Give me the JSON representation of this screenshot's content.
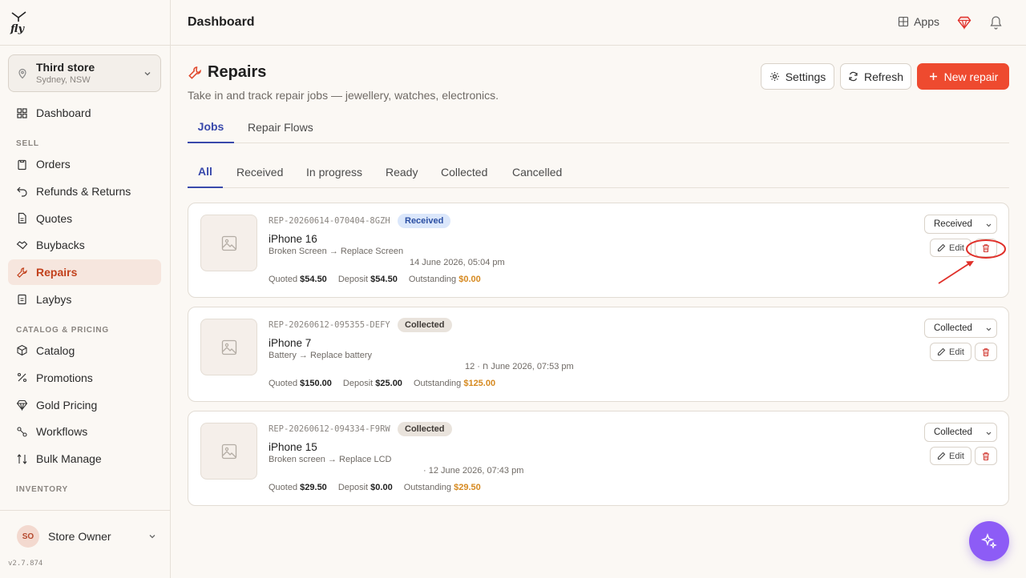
{
  "app": {
    "version": "v2.7.874",
    "topbar_title": "Dashboard",
    "apps_label": "Apps"
  },
  "store": {
    "name": "Third store",
    "location": "Sydney, NSW"
  },
  "sidebar": {
    "items": [
      {
        "label": "Dashboard",
        "icon": "grid-icon"
      },
      {
        "section": "SELL"
      },
      {
        "label": "Orders",
        "icon": "clipboard-icon"
      },
      {
        "label": "Refunds & Returns",
        "icon": "undo-icon"
      },
      {
        "label": "Quotes",
        "icon": "document-icon"
      },
      {
        "label": "Buybacks",
        "icon": "handshake-icon"
      },
      {
        "label": "Repairs",
        "icon": "wrench-icon",
        "active": true
      },
      {
        "label": "Laybys",
        "icon": "clipboard-icon"
      },
      {
        "section": "CATALOG & PRICING"
      },
      {
        "label": "Catalog",
        "icon": "box-icon"
      },
      {
        "label": "Promotions",
        "icon": "percent-icon"
      },
      {
        "label": "Gold Pricing",
        "icon": "gem-icon"
      },
      {
        "label": "Workflows",
        "icon": "link-icon"
      },
      {
        "label": "Bulk Manage",
        "icon": "sort-icon"
      },
      {
        "section": "INVENTORY"
      }
    ]
  },
  "user": {
    "initials": "SO",
    "name": "Store Owner"
  },
  "page": {
    "title": "Repairs",
    "subtitle": "Take in and track repair jobs — jewellery, watches, electronics.",
    "settings_label": "Settings",
    "refresh_label": "Refresh",
    "new_label": "New repair"
  },
  "tabs": [
    {
      "label": "Jobs",
      "active": true
    },
    {
      "label": "Repair Flows"
    }
  ],
  "filters": [
    {
      "label": "All",
      "active": true
    },
    {
      "label": "Received"
    },
    {
      "label": "In progress"
    },
    {
      "label": "Ready"
    },
    {
      "label": "Collected"
    },
    {
      "label": "Cancelled"
    }
  ],
  "repairs": [
    {
      "ref": "REP-20260614-070404-8GZH",
      "status": "Received",
      "device": "iPhone 16",
      "issue": "Broken Screen → Replace Screen",
      "date": "14 June 2026, 05:04 pm",
      "quoted_label": "Quoted",
      "quoted": "$54.50",
      "deposit_label": "Deposit",
      "deposit": "$54.50",
      "outstanding_label": "Outstanding",
      "outstanding": "$0.00",
      "select_value": "Received",
      "edit_label": "Edit"
    },
    {
      "ref": "REP-20260612-095355-DEFY",
      "status": "Collected",
      "device": "iPhone 7",
      "issue": "Battery → Replace battery",
      "date": "ח · 12 June 2026, 07:53 pm",
      "quoted_label": "Quoted",
      "quoted": "$150.00",
      "deposit_label": "Deposit",
      "deposit": "$25.00",
      "outstanding_label": "Outstanding",
      "outstanding": "$125.00",
      "select_value": "Collected",
      "edit_label": "Edit"
    },
    {
      "ref": "REP-20260612-094334-F9RW",
      "status": "Collected",
      "device": "iPhone 15",
      "issue": "Broken screen → Replace LCD",
      "date": "· 12 June 2026, 07:43 pm",
      "quoted_label": "Quoted",
      "quoted": "$29.50",
      "deposit_label": "Deposit",
      "deposit": "$0.00",
      "outstanding_label": "Outstanding",
      "outstanding": "$29.50",
      "select_value": "Collected",
      "edit_label": "Edit"
    }
  ],
  "colors": {
    "accent": "#ee4a2f",
    "tab_active": "#3949ab",
    "outstanding": "#d6891f",
    "annotation": "#e0302a",
    "fab": "#8d5cf6"
  }
}
